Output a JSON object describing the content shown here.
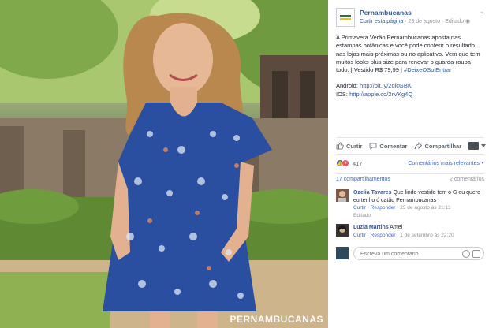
{
  "photo": {
    "watermark": "PERNAMBUCANAS"
  },
  "post": {
    "page_name": "Pernambucanas",
    "like_page": "Curtir esta página",
    "separator": "·",
    "date": "23 de agosto",
    "edited": "Editado",
    "body_line1": "A Primavera Verão Pernambucanas aposta nas estampas botânicas e você pode conferir o resultado nas lojas mais próximas ou no aplicativo. Vem que tem muitos looks plus size para renovar o guarda-roupa todo.  | Vestido R$ 79,99 |",
    "hashtag": "#DeixeOSolEntrar",
    "android_label": "Android:",
    "android_link": "http://bit.ly/2qlcGBK",
    "ios_label": "IOS:",
    "ios_link": "http://apple.co/2rVKg4Q"
  },
  "actions": {
    "like": "Curtir",
    "comment": "Comentar",
    "share": "Compartilhar"
  },
  "reactions": {
    "count": "417",
    "sort": "Comentários mais relevantes"
  },
  "counts": {
    "shares": "17 compartilhamentos",
    "comments": "2 comentários"
  },
  "comments": [
    {
      "author": "Ozelia Tavares",
      "text": "Que lindo vestido tem ó G eu quero eu tenho ó catão Pernambucanas",
      "like": "Curtir",
      "reply": "Responder",
      "time": "25 de agosto às 21:13",
      "edited": "Editado"
    },
    {
      "author": "Luzia Martins",
      "text": "Amei",
      "like": "Curtir",
      "reply": "Responder",
      "time": "1 de setembro às 22:20"
    }
  ],
  "composer": {
    "placeholder": "Escreva um comentário..."
  },
  "colors": {
    "link": "#365899",
    "accent": "#4267b2",
    "dress": "#2a4fa0"
  }
}
